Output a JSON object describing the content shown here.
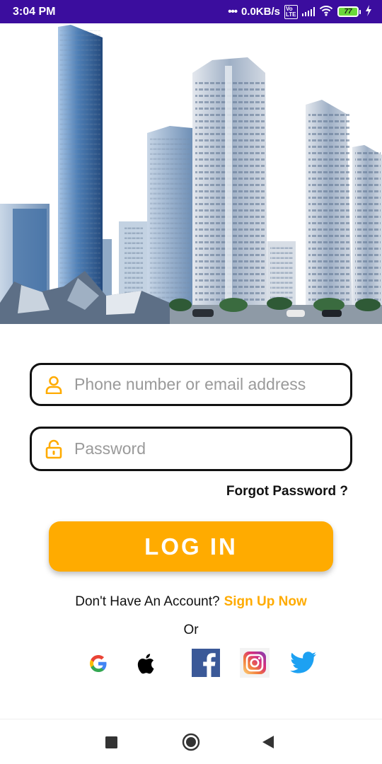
{
  "status_bar": {
    "time": "3:04 PM",
    "network_speed": "0.0KB/s",
    "volte_label": "Vo LTE",
    "battery_level": "77",
    "icons": [
      "more-dots-icon",
      "volte-icon",
      "signal-icon",
      "wifi-icon",
      "battery-icon",
      "charging-icon"
    ]
  },
  "hero": {
    "image": "city-skyline-buildings",
    "sky_color": "#ffffff",
    "building_color": "#5b7ea6"
  },
  "login_form": {
    "identifier_placeholder": "Phone number or email address",
    "identifier_value": "",
    "password_placeholder": "Password",
    "password_value": "",
    "identifier_icon": "user-icon",
    "password_icon": "padlock-icon",
    "forgot_password_label": "Forgot Password ?",
    "login_button_label": "LOG IN"
  },
  "signup": {
    "prompt": "Don't Have An Account?",
    "link_label": "Sign Up Now"
  },
  "divider_label": "Or",
  "social_logins": [
    "google-icon",
    "apple-icon",
    "facebook-icon",
    "instagram-icon",
    "twitter-icon"
  ],
  "navigation_bar": [
    "recents-square-icon",
    "home-circle-icon",
    "back-triangle-icon"
  ],
  "colors": {
    "accent": "#ffab00",
    "status_bar": "#3b0d9e",
    "field_border": "#111111",
    "placeholder": "#9a9a9a"
  }
}
